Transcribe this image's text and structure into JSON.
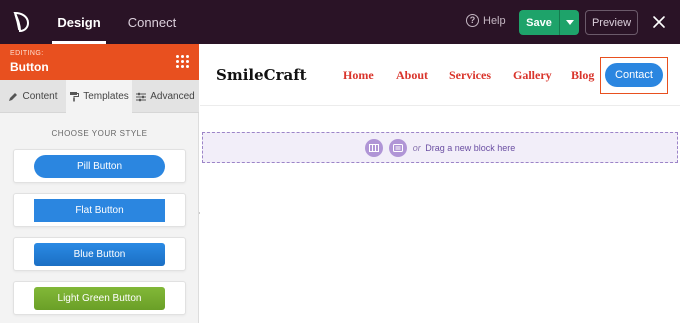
{
  "topbar": {
    "tabs": [
      {
        "label": "Design",
        "active": true
      },
      {
        "label": "Connect",
        "active": false
      }
    ],
    "help_label": "Help",
    "save_label": "Save",
    "preview_label": "Preview",
    "bg_color": "#2a1326"
  },
  "panel": {
    "editing_label": "EDITING:",
    "editing_title": "Button",
    "accent_color": "#e8501f",
    "tabs": [
      {
        "label": "Content",
        "icon": "pencil-icon"
      },
      {
        "label": "Templates",
        "icon": "paint-roller-icon",
        "active": true
      },
      {
        "label": "Advanced",
        "icon": "sliders-icon"
      }
    ],
    "choose_label": "CHOOSE YOUR STYLE",
    "templates": [
      {
        "label": "Pill Button",
        "color": "#2b86e0"
      },
      {
        "label": "Flat Button",
        "color": "#2b86e0"
      },
      {
        "label": "Blue Button",
        "color": "#1b6fc4"
      },
      {
        "label": "Light Green Button",
        "color": "#7ab232"
      }
    ]
  },
  "preview": {
    "brand": "SmileCraft",
    "nav": [
      "Home",
      "About",
      "Services",
      "Gallery",
      "Blog"
    ],
    "nav_color": "#d9342b",
    "contact_label": "Contact",
    "dropzone": {
      "or_label": "or",
      "drag_label": "Drag a new block here"
    }
  }
}
